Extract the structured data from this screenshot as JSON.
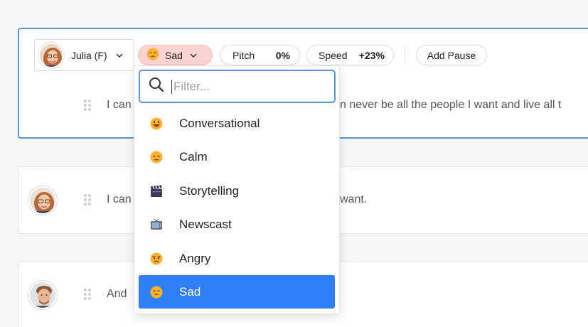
{
  "block1": {
    "voice_name": "Julia (F)",
    "emotion_label": "Sad",
    "pitch_label": "Pitch",
    "pitch_value": "0%",
    "speed_label": "Speed",
    "speed_value": "+23%",
    "add_pause_label": "Add Pause",
    "text_left": "I can",
    "text_right": "n never be all the people I want and live all t"
  },
  "block2": {
    "text_left": "I can",
    "text_right": "want."
  },
  "block3": {
    "text_left": "And"
  },
  "dropdown": {
    "filter_placeholder": "Filter...",
    "options": [
      {
        "label": "Conversational",
        "icon": "grinning-face-icon"
      },
      {
        "label": "Calm",
        "icon": "relieved-face-icon"
      },
      {
        "label": "Storytelling",
        "icon": "clapper-board-icon"
      },
      {
        "label": "Newscast",
        "icon": "television-icon"
      },
      {
        "label": "Angry",
        "icon": "angry-face-icon"
      },
      {
        "label": "Sad",
        "icon": "pensive-face-icon",
        "selected": true
      }
    ]
  },
  "colors": {
    "accent": "#2f7ef7",
    "focus_border": "#5b93e0",
    "emotion_pill_bg": "#fbd3d1"
  }
}
